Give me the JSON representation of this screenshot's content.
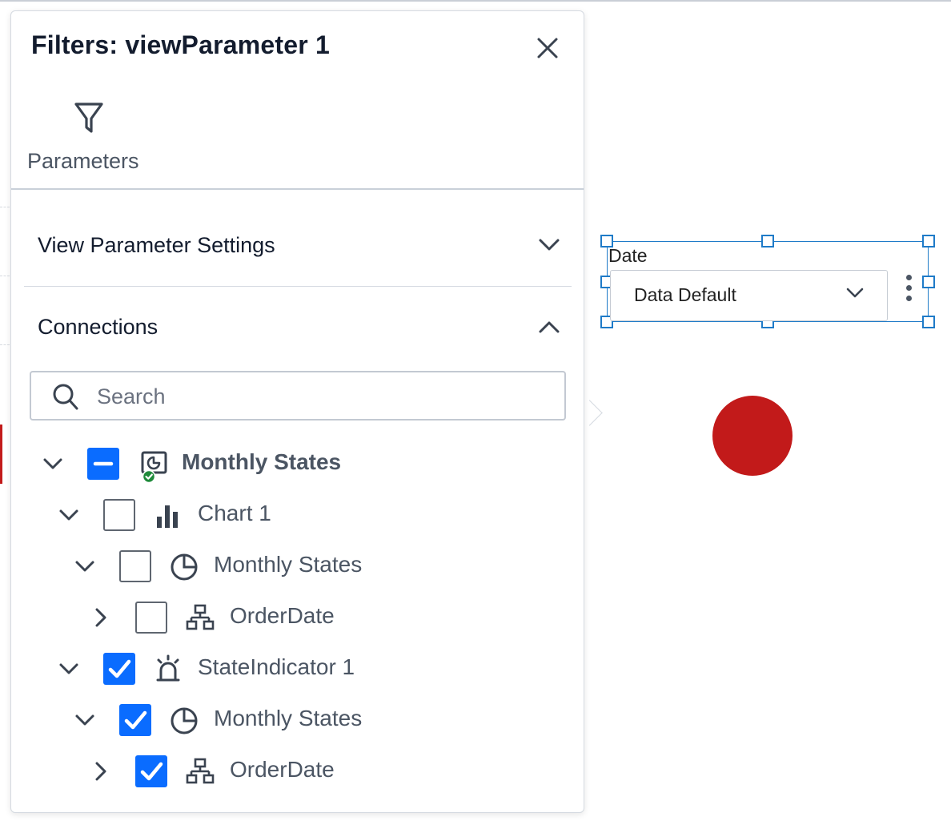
{
  "panel": {
    "title": "Filters: viewParameter 1",
    "tabs": [
      {
        "label": "Parameters",
        "icon": "filter-icon"
      }
    ],
    "sections": [
      {
        "title": "View Parameter Settings",
        "expanded": false
      },
      {
        "title": "Connections",
        "expanded": true
      }
    ],
    "search": {
      "placeholder": "Search",
      "value": ""
    },
    "tree": [
      {
        "label": "Monthly States",
        "icon": "dashboard-icon",
        "state": "partial",
        "expanded": true,
        "bold": true
      },
      {
        "label": "Chart 1",
        "icon": "bar-chart-icon",
        "state": "unchecked",
        "expanded": true
      },
      {
        "label": "Monthly States",
        "icon": "pie-chart-icon",
        "state": "unchecked",
        "expanded": true
      },
      {
        "label": "OrderDate",
        "icon": "hierarchy-icon",
        "state": "unchecked",
        "expanded": false
      },
      {
        "label": "StateIndicator 1",
        "icon": "siren-icon",
        "state": "checked",
        "expanded": true
      },
      {
        "label": "Monthly States",
        "icon": "pie-chart-icon",
        "state": "checked",
        "expanded": true
      },
      {
        "label": "OrderDate",
        "icon": "hierarchy-icon",
        "state": "checked",
        "expanded": false
      }
    ]
  },
  "widget": {
    "label": "Date",
    "dropdown_value": "Data Default",
    "indicator_color": "#c21a1a"
  },
  "colors": {
    "accent": "#0a6cff",
    "selection": "#1f7bc8",
    "success": "#1e8a3a"
  }
}
